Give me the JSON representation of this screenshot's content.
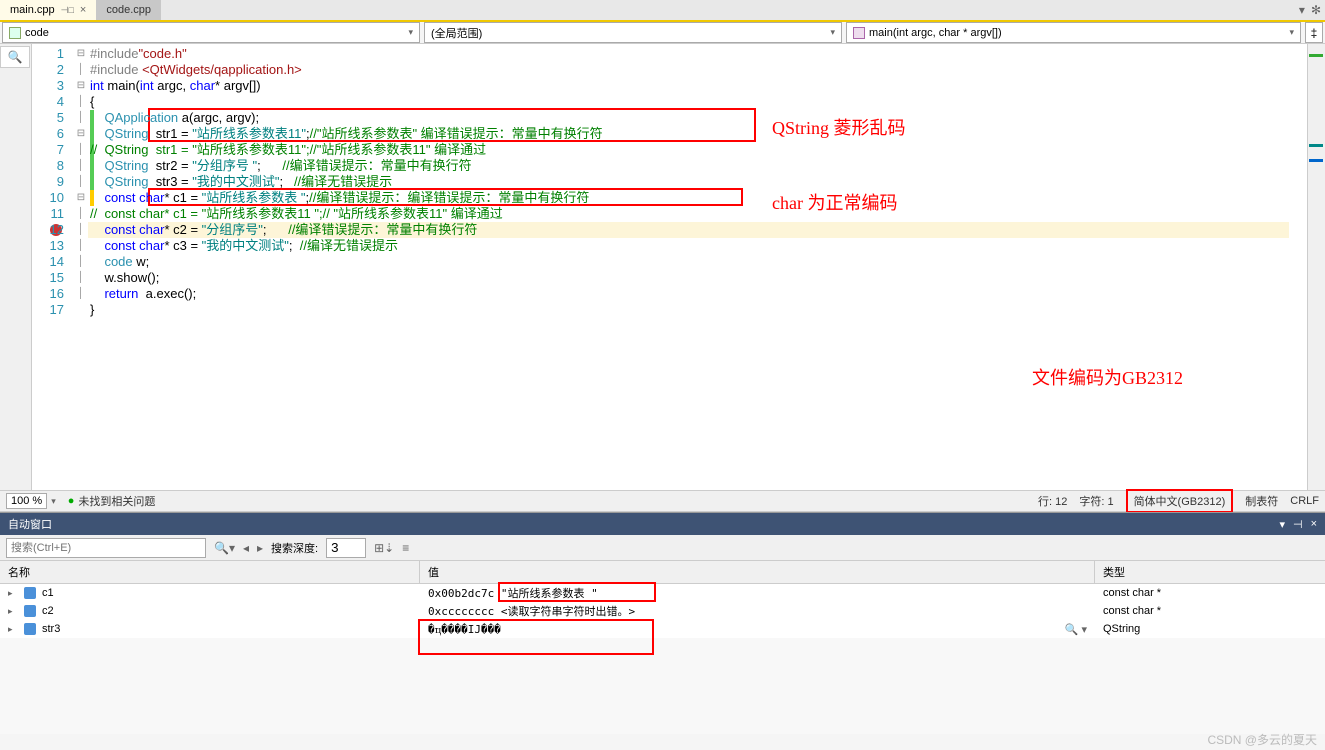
{
  "tabs": {
    "active": "main.cpp",
    "inactive": "code.cpp"
  },
  "dropdowns": {
    "scope": "code",
    "context": "(全局范围)",
    "member": "main(int argc, char * argv[])"
  },
  "code": {
    "lines": [
      {
        "n": 1,
        "fold": "⊟",
        "html": "<span class='prep'>#include</span><span class='inc'>\"code.h\"</span>"
      },
      {
        "n": 2,
        "fold": "│",
        "html": "<span class='prep'>#include</span> <span class='inc'>&lt;QtWidgets/qapplication.h&gt;</span>"
      },
      {
        "n": 3,
        "fold": "⊟",
        "html": "<span class='kw'>int</span> <span class='ident'>main</span>(<span class='kw'>int</span> argc, <span class='kw'>char</span>* argv[])"
      },
      {
        "n": 4,
        "fold": "│",
        "html": "{"
      },
      {
        "n": 5,
        "fold": "│",
        "html": "    <span class='type'>QApplication</span> a(argc, argv);"
      },
      {
        "n": 6,
        "fold": "⊟",
        "html": "    <span class='type'>QString</span>  str1 = <span class='str'>\"站所线系参数表11\"</span>;<span class='cmt'>//\"站所线系参数表\" 编译错误提示：常量中有换行符</span>"
      },
      {
        "n": 7,
        "fold": "│",
        "html": "<span class='cmt'>//  QString  str1 = \"站所线系参数表11\";//\"站所线系参数表11\" 编译通过</span>"
      },
      {
        "n": 8,
        "fold": "│",
        "html": "    <span class='type'>QString</span>  str2 = <span class='str'>\"分组序号 \"</span>;      <span class='cmt'>//编译错误提示：常量中有换行符</span>"
      },
      {
        "n": 9,
        "fold": "│",
        "html": "    <span class='type'>QString</span>  str3 = <span class='str'>\"我的中文测试\"</span>;   <span class='cmt'>//编译无错误提示</span>"
      },
      {
        "n": 10,
        "fold": "⊟",
        "html": "    <span class='kw'>const</span> <span class='kw'>char</span>* c1 = <span class='str'>\"站所线系参数表 \"</span>;<span class='cmt'>//编译错误提示：编译错误提示：常量中有换行符</span>"
      },
      {
        "n": 11,
        "fold": "│",
        "html": "<span class='cmt'>//  const char* c1 = \"站所线系参数表11 \";// \"站所线系参数表11\" 编译通过</span>"
      },
      {
        "n": 12,
        "fold": "│",
        "html": "    <span class='kw'>const</span> <span class='kw'>char</span>* c2 = <span class='str'>\"分组序号\"</span>;      <span class='cmt'>//编译错误提示：常量中有换行符</span>"
      },
      {
        "n": 13,
        "fold": "│",
        "html": "    <span class='kw'>const</span> <span class='kw'>char</span>* c3 = <span class='str'>\"我的中文测试\"</span>;  <span class='cmt'>//编译无错误提示</span>"
      },
      {
        "n": 14,
        "fold": "│",
        "html": "    <span class='type'>code</span> w;"
      },
      {
        "n": 15,
        "fold": "│",
        "html": "    w.show();"
      },
      {
        "n": 16,
        "fold": "│",
        "html": "    <span class='kw'>return</span>  a.exec();"
      },
      {
        "n": 17,
        "fold": " ",
        "html": "}"
      }
    ]
  },
  "annotations": {
    "qstring": "QString 菱形乱码",
    "char": "char 为正常编码",
    "encoding": "文件编码为GB2312"
  },
  "status": {
    "zoom": "100 %",
    "issues": "未找到相关问题",
    "line": "行: 12",
    "char": "字符: 1",
    "encoding": "简体中文(GB2312)",
    "tab": "制表符",
    "crlf": "CRLF"
  },
  "autoPanel": {
    "title": "自动窗口",
    "searchPlaceholder": "搜索(Ctrl+E)",
    "depthLabel": "搜索深度:",
    "depthValue": "3",
    "headers": {
      "name": "名称",
      "value": "值",
      "type": "类型"
    },
    "rows": [
      {
        "name": "c1",
        "value": "0x00b2dc7c \"站所线系参数表 \"",
        "type": "const char *"
      },
      {
        "name": "c2",
        "value": "0xcccccccc <读取字符串字符时出错。>",
        "type": "const char *"
      },
      {
        "name": "str3",
        "value": "�ҵ����IJ���",
        "type": "QString",
        "mag": true
      }
    ]
  },
  "watermark": "CSDN @多云的夏天"
}
